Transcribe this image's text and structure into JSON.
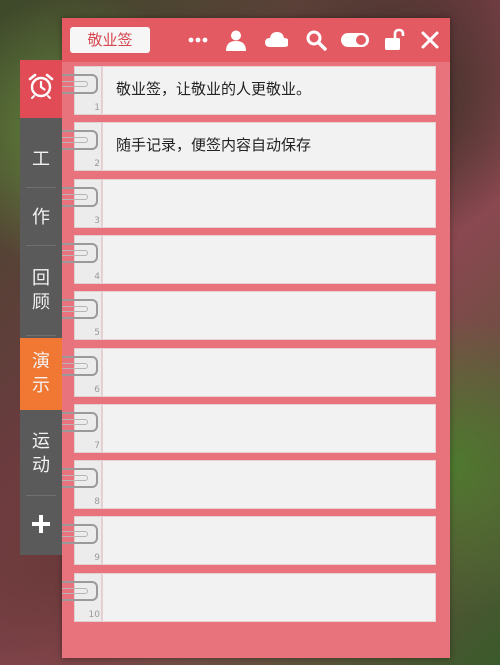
{
  "app": {
    "title": "敬业签"
  },
  "toolbar": {
    "icons": [
      "more-icon",
      "user-icon",
      "cloud-icon",
      "search-icon",
      "toggle-icon",
      "unlock-icon",
      "close-icon"
    ]
  },
  "sidebar": {
    "items": [
      {
        "icon": "alarm-clock-icon",
        "label": ""
      },
      {
        "label": "工"
      },
      {
        "label": "作"
      },
      {
        "label": "回\n顾"
      },
      {
        "label": "演\n示"
      },
      {
        "label": "运\n动"
      },
      {
        "icon": "plus-icon",
        "label": "+"
      }
    ]
  },
  "notes": [
    {
      "num": "1",
      "text": "敬业签，让敬业的人更敬业。"
    },
    {
      "num": "2",
      "text": "随手记录，便签内容自动保存"
    },
    {
      "num": "3",
      "text": ""
    },
    {
      "num": "4",
      "text": ""
    },
    {
      "num": "5",
      "text": ""
    },
    {
      "num": "6",
      "text": ""
    },
    {
      "num": "7",
      "text": ""
    },
    {
      "num": "8",
      "text": ""
    },
    {
      "num": "9",
      "text": ""
    },
    {
      "num": "10",
      "text": ""
    }
  ],
  "colors": {
    "accent": "#e45a63",
    "active_tab": "#f07833",
    "sidebar": "#5a5a5a"
  }
}
